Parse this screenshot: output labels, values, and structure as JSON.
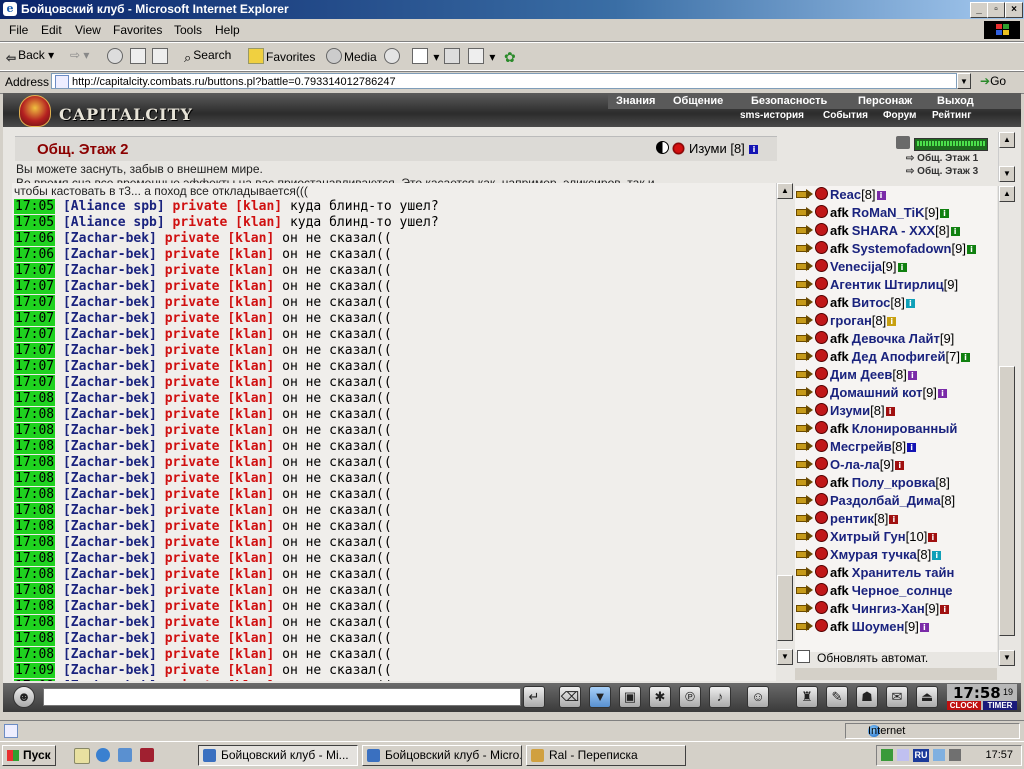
{
  "window": {
    "title": "Бойцовский клуб - Microsoft Internet Explorer"
  },
  "menu": [
    "File",
    "Edit",
    "View",
    "Favorites",
    "Tools",
    "Help"
  ],
  "toolbar": {
    "back": "Back",
    "search": "Search",
    "favorites": "Favorites",
    "media": "Media"
  },
  "address": {
    "label": "Address",
    "url": "http://capitalcity.combats.ru/buttons.pl?battle=0.793314012786247",
    "go": "Go"
  },
  "game": {
    "logo": "CAPITALCITY",
    "nav": [
      "Знания",
      "Общение",
      "Безопасность",
      "Персонаж",
      "Выход"
    ],
    "subnav": [
      "sms-история",
      "События",
      "Форум",
      "Рейтинг"
    ],
    "room": {
      "name": "Общ. Этаж 2",
      "user": "Изуми",
      "user_level": "[8]"
    },
    "description": [
      "Вы можете заснуть, забыв о внешнем мире.",
      "Во время сна все временные эффекты на вас приостанавливаются. Это касается как, например, эликсиров, так и",
      "чтобы кастовать в т3... а поход все откладывается((("
    ],
    "floors": [
      "Общ. Этаж 1",
      "Общ. Этаж 3"
    ],
    "chat_lines": [
      {
        "time": "17:05",
        "nick": "[Aliance spb]",
        "text": "куда блинд-то ушел?"
      },
      {
        "time": "17:05",
        "nick": "[Aliance spb]",
        "text": "куда блинд-то ушел?"
      },
      {
        "time": "17:06",
        "nick": "[Zachar-bek]",
        "text": "он не сказал(("
      },
      {
        "time": "17:06",
        "nick": "[Zachar-bek]",
        "text": "он не сказал(("
      },
      {
        "time": "17:07",
        "nick": "[Zachar-bek]",
        "text": "он не сказал(("
      },
      {
        "time": "17:07",
        "nick": "[Zachar-bek]",
        "text": "он не сказал(("
      },
      {
        "time": "17:07",
        "nick": "[Zachar-bek]",
        "text": "он не сказал(("
      },
      {
        "time": "17:07",
        "nick": "[Zachar-bek]",
        "text": "он не сказал(("
      },
      {
        "time": "17:07",
        "nick": "[Zachar-bek]",
        "text": "он не сказал(("
      },
      {
        "time": "17:07",
        "nick": "[Zachar-bek]",
        "text": "он не сказал(("
      },
      {
        "time": "17:07",
        "nick": "[Zachar-bek]",
        "text": "он не сказал(("
      },
      {
        "time": "17:07",
        "nick": "[Zachar-bek]",
        "text": "он не сказал(("
      },
      {
        "time": "17:08",
        "nick": "[Zachar-bek]",
        "text": "он не сказал(("
      },
      {
        "time": "17:08",
        "nick": "[Zachar-bek]",
        "text": "он не сказал(("
      },
      {
        "time": "17:08",
        "nick": "[Zachar-bek]",
        "text": "он не сказал(("
      },
      {
        "time": "17:08",
        "nick": "[Zachar-bek]",
        "text": "он не сказал(("
      },
      {
        "time": "17:08",
        "nick": "[Zachar-bek]",
        "text": "он не сказал(("
      },
      {
        "time": "17:08",
        "nick": "[Zachar-bek]",
        "text": "он не сказал(("
      },
      {
        "time": "17:08",
        "nick": "[Zachar-bek]",
        "text": "он не сказал(("
      },
      {
        "time": "17:08",
        "nick": "[Zachar-bek]",
        "text": "он не сказал(("
      },
      {
        "time": "17:08",
        "nick": "[Zachar-bek]",
        "text": "он не сказал(("
      },
      {
        "time": "17:08",
        "nick": "[Zachar-bek]",
        "text": "он не сказал(("
      },
      {
        "time": "17:08",
        "nick": "[Zachar-bek]",
        "text": "он не сказал(("
      },
      {
        "time": "17:08",
        "nick": "[Zachar-bek]",
        "text": "он не сказал(("
      },
      {
        "time": "17:08",
        "nick": "[Zachar-bek]",
        "text": "он не сказал(("
      },
      {
        "time": "17:08",
        "nick": "[Zachar-bek]",
        "text": "он не сказал(("
      },
      {
        "time": "17:08",
        "nick": "[Zachar-bek]",
        "text": "он не сказал(("
      },
      {
        "time": "17:08",
        "nick": "[Zachar-bek]",
        "text": "он не сказал(("
      },
      {
        "time": "17:08",
        "nick": "[Zachar-bek]",
        "text": "он не сказал(("
      },
      {
        "time": "17:09",
        "nick": "[Zachar-bek]",
        "text": "он не сказал(("
      },
      {
        "time": "17:09",
        "nick": "[Zachar-bek]",
        "text": "он не сказал(("
      }
    ],
    "private_label": "private [klan]",
    "users": [
      {
        "afk": "",
        "name": "Reac",
        "level": "[8]",
        "info": "purple"
      },
      {
        "afk": "afk",
        "name": "RoMaN_TiK",
        "level": "[9]",
        "info": "green"
      },
      {
        "afk": "afk",
        "name": "SHARA - XXX",
        "level": "[8]",
        "info": "green"
      },
      {
        "afk": "afk",
        "name": "Systemofadown",
        "level": "[9]",
        "info": "green"
      },
      {
        "afk": "",
        "name": "Venecija",
        "level": "[9]",
        "info": "green"
      },
      {
        "afk": "",
        "name": "Агентик Штирлиц",
        "level": "[9]",
        "info": ""
      },
      {
        "afk": "afk",
        "name": "Витос",
        "level": "[8]",
        "info": "cyan"
      },
      {
        "afk": "",
        "name": "гроган",
        "level": "[8]",
        "info": "yellow"
      },
      {
        "afk": "afk",
        "name": "Девочка Лайт",
        "level": "[9]",
        "info": ""
      },
      {
        "afk": "afk",
        "name": "Дед Апофигей",
        "level": "[7]",
        "info": "green"
      },
      {
        "afk": "",
        "name": "Дим Деев",
        "level": "[8]",
        "info": "purple"
      },
      {
        "afk": "",
        "name": "Домашний кот",
        "level": "[9]",
        "info": "purple"
      },
      {
        "afk": "",
        "name": "Изуми",
        "level": "[8]",
        "info": "red"
      },
      {
        "afk": "afk",
        "name": "Клонированный",
        "level": "",
        "info": ""
      },
      {
        "afk": "",
        "name": "Месгрейв",
        "level": "[8]",
        "info": "blue"
      },
      {
        "afk": "",
        "name": "О-ла-ла",
        "level": "[9]",
        "info": "red"
      },
      {
        "afk": "afk",
        "name": "Полу_кровка",
        "level": "[8]",
        "info": ""
      },
      {
        "afk": "",
        "name": "Раздолбай_Дима",
        "level": "[8]",
        "info": ""
      },
      {
        "afk": "",
        "name": "рентик",
        "level": "[8]",
        "info": "red"
      },
      {
        "afk": "",
        "name": "Хитрый Гун",
        "level": "[10]",
        "info": "red"
      },
      {
        "afk": "",
        "name": "Хмурая тучка",
        "level": "[8]",
        "info": "cyan"
      },
      {
        "afk": "afk",
        "name": "Хранитель тайн",
        "level": "",
        "info": ""
      },
      {
        "afk": "afk",
        "name": "Черное_солнце",
        "level": "",
        "info": ""
      },
      {
        "afk": "afk",
        "name": "Чингиз-Хан",
        "level": "[9]",
        "info": "red"
      },
      {
        "afk": "afk",
        "name": "Шоумен",
        "level": "[9]",
        "info": "purple"
      }
    ],
    "auto_update": "Обновлять автомат.",
    "clock": {
      "time": "17:58",
      "seconds": "19",
      "label_clock": "CLOCK",
      "label_timer": "TIMER"
    }
  },
  "status": {
    "zone": "Internet"
  },
  "taskbar": {
    "start": "Пуск",
    "tasks": [
      "Бойцовский клуб - Mi...",
      "Бойцовский клуб - Micro...",
      "Ral - Переписка"
    ],
    "lang": "RU",
    "time": "17:57"
  }
}
